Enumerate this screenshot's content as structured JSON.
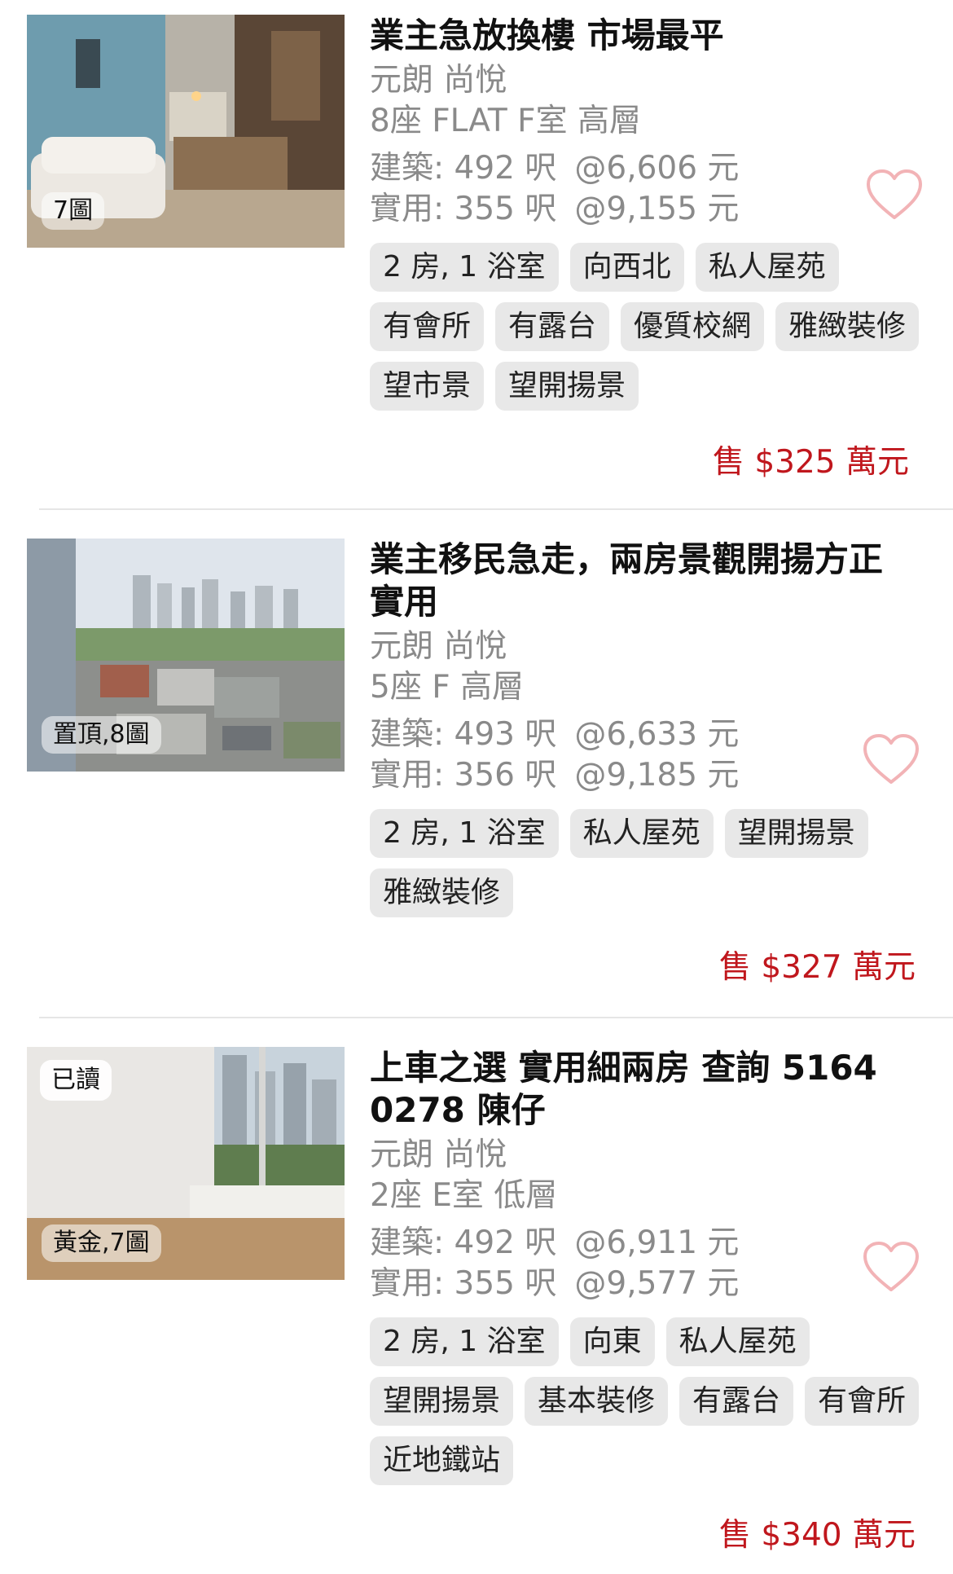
{
  "listings": [
    {
      "title": "業主急放換樓 市場最平",
      "estate": "元朗 尚悅",
      "unit": "8座 FLAT F室 高層",
      "gross": "建築: 492 呎",
      "gross_ppsf": "@6,606 元",
      "saleable": "實用: 355 呎",
      "saleable_ppsf": "@9,155 元",
      "tags": [
        "2 房, 1 浴室",
        "向西北",
        "私人屋苑",
        "有會所",
        "有露台",
        "優質校網",
        "雅緻裝修",
        "望市景",
        "望開揚景"
      ],
      "photo_badge": "7圖",
      "read_badge": "",
      "price": "售 $325 萬元",
      "favorite_icon": "heart-outline-icon"
    },
    {
      "title": "業主移民急走，兩房景觀開揚方正實用",
      "estate": "元朗 尚悅",
      "unit": "5座 F 高層",
      "gross": "建築: 493 呎",
      "gross_ppsf": "@6,633 元",
      "saleable": "實用: 356 呎",
      "saleable_ppsf": "@9,185 元",
      "tags": [
        "2 房, 1 浴室",
        "私人屋苑",
        "望開揚景",
        "雅緻裝修"
      ],
      "photo_badge": "置頂,8圖",
      "read_badge": "",
      "price": "售 $327 萬元",
      "favorite_icon": "heart-outline-icon"
    },
    {
      "title": "上車之選  實用細兩房 查詢 5164 0278 陳仔",
      "estate": "元朗 尚悅",
      "unit": "2座 E室 低層",
      "gross": "建築: 492 呎",
      "gross_ppsf": "@6,911 元",
      "saleable": "實用: 355 呎",
      "saleable_ppsf": "@9,577 元",
      "tags": [
        "2 房, 1 浴室",
        "向東",
        "私人屋苑",
        "望開揚景",
        "基本裝修",
        "有露台",
        "有會所",
        "近地鐵站"
      ],
      "photo_badge": "黃金,7圖",
      "read_badge": "已讀",
      "price": "售 $340 萬元",
      "favorite_icon": "heart-outline-icon"
    }
  ],
  "colors": {
    "price": "#c0171d",
    "heart": "#f2b3b6",
    "tag_bg": "#e8e8e8",
    "muted_text": "#8a8a8a"
  }
}
